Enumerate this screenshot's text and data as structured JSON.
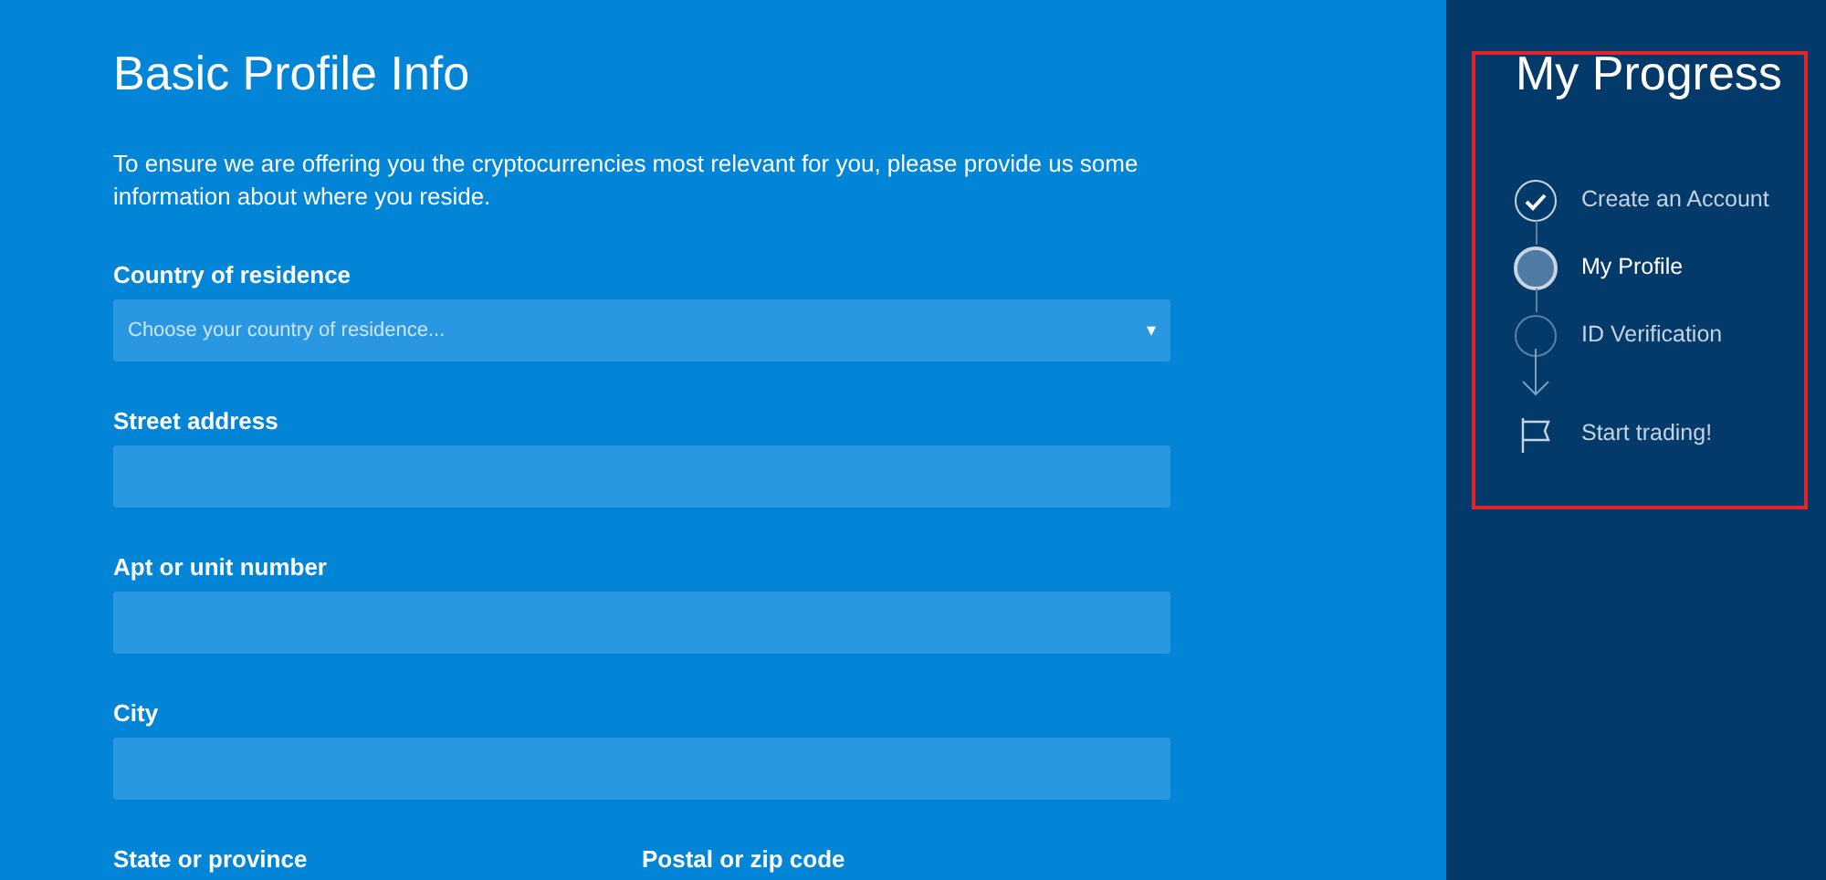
{
  "form": {
    "title": "Basic Profile Info",
    "intro": "To ensure we are offering you the cryptocurrencies most relevant for you, please provide us some information about where you reside.",
    "fields": [
      {
        "kind": "select",
        "label": "Country of residence",
        "placeholder": "Choose your country of residence...",
        "caret": "▾"
      },
      {
        "kind": "text",
        "label": "Street address"
      },
      {
        "kind": "text",
        "label": "Apt or unit number"
      },
      {
        "kind": "text",
        "label": "City"
      }
    ],
    "split_fields": [
      {
        "label": "State or province"
      },
      {
        "label": "Postal or zip code"
      }
    ]
  },
  "progress": {
    "title": "My Progress",
    "highlighted": true,
    "steps": [
      {
        "kind": "step",
        "label": "Create an Account",
        "completed": true,
        "selected": false
      },
      {
        "kind": "step",
        "label": "My Profile",
        "completed": false,
        "selected": true
      },
      {
        "kind": "step",
        "label": "ID Verification",
        "completed": false,
        "selected": false
      },
      {
        "kind": "goal",
        "label": "Start trading!"
      }
    ]
  }
}
